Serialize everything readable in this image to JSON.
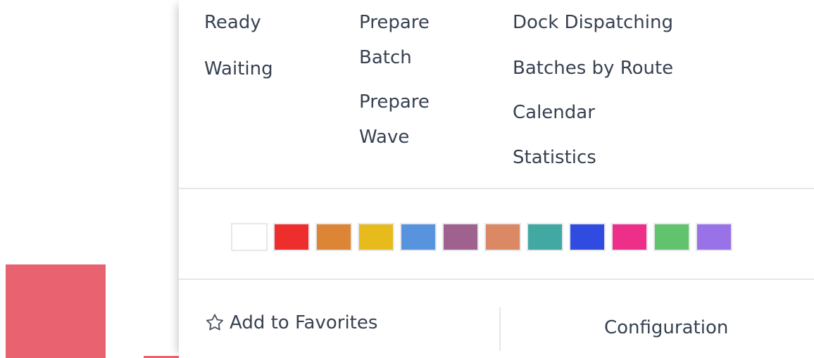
{
  "menu": {
    "filter_items": [
      {
        "label": "Ready"
      },
      {
        "label": "Waiting"
      }
    ],
    "operations_items": [
      {
        "label": "Prepare Batch"
      },
      {
        "label": "Prepare Wave"
      }
    ],
    "reports_items": [
      {
        "label": "Dock Dispatching"
      },
      {
        "label": "Batches by Route"
      },
      {
        "label": "Calendar"
      },
      {
        "label": "Statistics"
      }
    ]
  },
  "color_picker": {
    "colors": [
      "#ffffff",
      "#ee2d2d",
      "#dc8534",
      "#e8bb1d",
      "#5794dd",
      "#9f628f",
      "#db8865",
      "#41a9a2",
      "#304be0",
      "#ee2f8a",
      "#61c36e",
      "#9872e6"
    ]
  },
  "footer": {
    "favorites_label": "Add to Favorites",
    "favorites_icon": "star-outline-icon",
    "configuration_label": "Configuration"
  },
  "colors": {
    "background_card": "#e8626f",
    "divider": "#e5e7eb",
    "text": "#374151"
  }
}
